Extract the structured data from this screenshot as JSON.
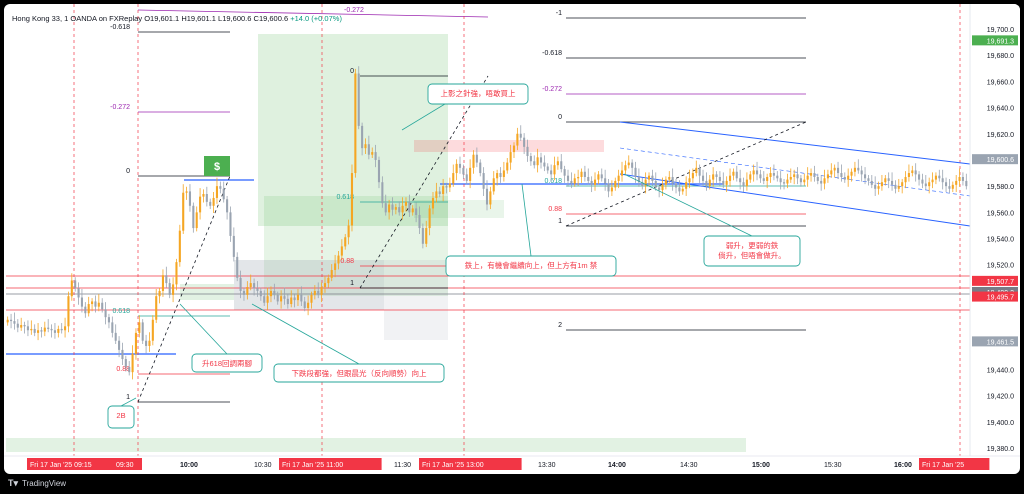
{
  "header": {
    "symbol": "Hong Kong 33, 1",
    "broker": "OANDA on FXReplay",
    "open_label": "O",
    "open": "19,601.1",
    "high_label": "H",
    "high": "19,601.1",
    "low_label": "L",
    "low": "19,600.6",
    "close_label": "C",
    "close": "19,600.6",
    "change": "+14.0 (+0.07%)"
  },
  "footer": {
    "brand": "TradingView"
  },
  "colors": {
    "up": "#f5a623",
    "down": "#9aa4b1",
    "red": "#f23645",
    "blue": "#2962ff",
    "green": "#4caf50",
    "purple": "#9c27b0",
    "teal": "#26a69a"
  },
  "chart_data": {
    "type": "candlestick",
    "title": "",
    "ylim": [
      19374,
      19716
    ],
    "y_ticks": [
      19700,
      19680,
      19660,
      19640,
      19620,
      19600,
      19580,
      19560,
      19540,
      19520,
      19440,
      19420,
      19400,
      19380
    ],
    "price_badges": [
      {
        "value": "19,691.3",
        "color": "#4caf50"
      },
      {
        "value": "19,600.6",
        "color": "#9aa4b1"
      },
      {
        "value": "19,507.7",
        "color": "#f23645"
      },
      {
        "value": "19,499.2",
        "color": "#f23645"
      },
      {
        "value": "19,499.2",
        "color": "#787b86"
      },
      {
        "value": "19,495.7",
        "color": "#f23645"
      },
      {
        "value": "19,461.5",
        "color": "#9aa4b1"
      }
    ],
    "x_ticks": [
      {
        "label": "Fri 17 Jan '25  09:15",
        "highlight": true
      },
      {
        "label": "09:30",
        "highlight": true
      },
      {
        "label": "10:00",
        "highlight": false,
        "bold": true
      },
      {
        "label": "10:30",
        "highlight": false
      },
      {
        "label": "Fri 17 Jan '25  11:00",
        "highlight": true
      },
      {
        "label": "11:30",
        "highlight": false
      },
      {
        "label": "Fri 17 Jan '25  13:00",
        "highlight": true
      },
      {
        "label": "13:30",
        "highlight": false
      },
      {
        "label": "14:00",
        "highlight": false,
        "bold": true
      },
      {
        "label": "14:30",
        "highlight": false
      },
      {
        "label": "15:00",
        "highlight": false,
        "bold": true
      },
      {
        "label": "15:30",
        "highlight": false
      },
      {
        "label": "16:00",
        "highlight": false,
        "bold": true
      },
      {
        "label": "Fri 17 Jan '25",
        "highlight": true
      }
    ],
    "fib_levels_left": [
      "-0.618",
      "-0.272",
      "0",
      "0.618",
      "0.88",
      "1"
    ],
    "fib_levels_mid": [
      "-0.272",
      "0",
      "0.618",
      "0.88",
      "1"
    ],
    "fib_levels_right": [
      "-1",
      "-0.618",
      "-0.272",
      "0",
      "0.618",
      "0.88",
      "1",
      "2"
    ],
    "annotations": [
      "上影之針強，唔敢買上",
      "鉄上，有機會繼續向上，但上方有1m 禁",
      "弱升，更弱的鉄\n倘升，但唔會做升。",
      "升618回調兩腳",
      "下跌段都強，但跟晨光（反向順勢）向上",
      "2B"
    ],
    "closes": [
      19478,
      19477,
      19475,
      19472,
      19474,
      19473,
      19470,
      19471,
      19468,
      19470,
      19469,
      19472,
      19471,
      19470,
      19468,
      19471,
      19470,
      19473,
      19496,
      19508,
      19502,
      19495,
      19488,
      19483,
      19490,
      19492,
      19488,
      19491,
      19486,
      19480,
      19476,
      19468,
      19462,
      19455,
      19448,
      19442,
      19438,
      19452,
      19468,
      19476,
      19462,
      19458,
      19462,
      19478,
      19496,
      19500,
      19512,
      19506,
      19497,
      19505,
      19522,
      19546,
      19575,
      19576,
      19565,
      19548,
      19560,
      19572,
      19574,
      19568,
      19565,
      19571,
      19580,
      19578,
      19570,
      19560,
      19542,
      19526,
      19510,
      19500,
      19497,
      19503,
      19506,
      19502,
      19500,
      19496,
      19491,
      19496,
      19500,
      19497,
      19492,
      19496,
      19494,
      19490,
      19495,
      19493,
      19497,
      19492,
      19487,
      19491,
      19497,
      19500,
      19497,
      19503,
      19506,
      19510,
      19516,
      19521,
      19527,
      19534,
      19541,
      19550,
      19590,
      19666,
      19626,
      19609,
      19612,
      19604,
      19606,
      19600,
      19583,
      19567,
      19560,
      19566,
      19562,
      19564,
      19560,
      19565,
      19568,
      19560,
      19563,
      19558,
      19548,
      19536,
      19548,
      19563,
      19571,
      19576,
      19574,
      19580,
      19579,
      19582,
      19590,
      19597,
      19594,
      19589,
      19584,
      19594,
      19604,
      19598,
      19590,
      19578,
      19566,
      19576,
      19586,
      19590,
      19587,
      19592,
      19598,
      19606,
      19611,
      19620,
      19617,
      19610,
      19603,
      19599,
      19596,
      19602,
      19598,
      19595,
      19592,
      19589,
      19596,
      19599,
      19593,
      19588,
      19584,
      19582,
      19586,
      19587,
      19591,
      19587,
      19584,
      19581,
      19585,
      19589,
      19586,
      19582,
      19576,
      19579,
      19584,
      19588,
      19592,
      19596,
      19598,
      19594,
      19587,
      19583,
      19580,
      19585,
      19588,
      19584,
      19579,
      19577,
      19581,
      19585,
      19587,
      19582,
      19579,
      19576,
      19578,
      19583,
      19586,
      19590,
      19594,
      19588,
      19584,
      19580,
      19585,
      19589,
      19587,
      19584,
      19581,
      19584,
      19588,
      19591,
      19586,
      19583,
      19580,
      19585,
      19589,
      19592,
      19589,
      19586,
      19584,
      19587,
      19590,
      19588,
      19586,
      19583,
      19582,
      19585,
      19587,
      19589,
      19586,
      19583,
      19585,
      19588,
      19590,
      19587,
      19584,
      19582,
      19586,
      19589,
      19592,
      19594,
      19590,
      19587,
      19585,
      19588,
      19591,
      19594,
      19592,
      19589,
      19586,
      19584,
      19581,
      19578,
      19580,
      19583,
      19586,
      19584,
      19581,
      19578,
      19580,
      19583,
      19587,
      19590,
      19592,
      19589,
      19585,
      19582,
      19580,
      19583,
      19585,
      19588,
      19586,
      19583,
      19580,
      19578,
      19581,
      19584,
      19587,
      19584,
      19580
    ]
  }
}
